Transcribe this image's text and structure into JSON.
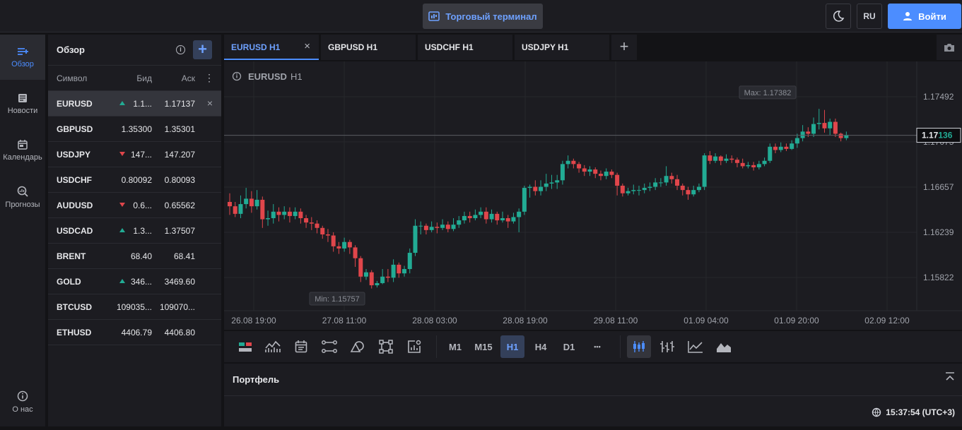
{
  "header": {
    "terminal_label": "Торговый терминал",
    "lang": "RU",
    "login_label": "Войти"
  },
  "nav": {
    "items": [
      {
        "label": "Обзор",
        "icon": "overview-icon"
      },
      {
        "label": "Новости",
        "icon": "news-icon"
      },
      {
        "label": "Календарь",
        "icon": "calendar-icon"
      },
      {
        "label": "Прогнозы",
        "icon": "forecast-icon"
      }
    ],
    "about": "О нас"
  },
  "watchlist": {
    "title": "Обзор",
    "col_symbol": "Символ",
    "col_bid": "Бид",
    "col_ask": "Аск",
    "rows": [
      {
        "symbol": "EURUSD",
        "bid": "1.1...",
        "ask": "1.17137",
        "trend": "up"
      },
      {
        "symbol": "GBPUSD",
        "bid": "1.35300",
        "ask": "1.35301",
        "trend": ""
      },
      {
        "symbol": "USDJPY",
        "bid": "147...",
        "ask": "147.207",
        "trend": "down"
      },
      {
        "symbol": "USDCHF",
        "bid": "0.80092",
        "ask": "0.80093",
        "trend": ""
      },
      {
        "symbol": "AUDUSD",
        "bid": "0.6...",
        "ask": "0.65562",
        "trend": "down"
      },
      {
        "symbol": "USDCAD",
        "bid": "1.3...",
        "ask": "1.37507",
        "trend": "up"
      },
      {
        "symbol": "BRENT",
        "bid": "68.40",
        "ask": "68.41",
        "trend": ""
      },
      {
        "symbol": "GOLD",
        "bid": "346...",
        "ask": "3469.60",
        "trend": "up"
      },
      {
        "symbol": "BTCUSD",
        "bid": "109035...",
        "ask": "109070...",
        "trend": ""
      },
      {
        "symbol": "ETHUSD",
        "bid": "4406.79",
        "ask": "4406.80",
        "trend": ""
      }
    ]
  },
  "tabs": [
    {
      "label": "EURUSD H1"
    },
    {
      "label": "GBPUSD H1"
    },
    {
      "label": "USDCHF H1"
    },
    {
      "label": "USDJPY H1"
    }
  ],
  "chart_data": {
    "type": "candlestick",
    "symbol": "EURUSD",
    "timeframe": "H1",
    "yticks": [
      "1.17492",
      "1.17075",
      "1.16657",
      "1.16239",
      "1.15822"
    ],
    "xticks": [
      "26.08 19:00",
      "27.08 11:00",
      "28.08 03:00",
      "28.08 19:00",
      "29.08 11:00",
      "01.09 04:00",
      "01.09 20:00",
      "02.09 12:00"
    ],
    "current_price_prefix": "1.17",
    "current_price_suffix": "136",
    "max_label": "Max: 1.17382",
    "min_label": "Min: 1.15757",
    "ylim": [
      1.1555,
      1.1775
    ],
    "candles": [
      [
        1.1652,
        1.1648,
        1.166,
        1.164
      ],
      [
        1.1648,
        1.1641,
        1.1652,
        1.1638
      ],
      [
        1.1641,
        1.165,
        1.1658,
        1.1637
      ],
      [
        1.165,
        1.1655,
        1.1665,
        1.1646
      ],
      [
        1.1655,
        1.1648,
        1.1662,
        1.1642
      ],
      [
        1.1648,
        1.1654,
        1.1663,
        1.1645
      ],
      [
        1.1654,
        1.1636,
        1.1657,
        1.1628
      ],
      [
        1.1636,
        1.1637,
        1.1644,
        1.163
      ],
      [
        1.1637,
        1.1643,
        1.165,
        1.1632
      ],
      [
        1.1643,
        1.164,
        1.1647,
        1.1634
      ],
      [
        1.164,
        1.1643,
        1.1648,
        1.1636
      ],
      [
        1.1643,
        1.1639,
        1.1647,
        1.1633
      ],
      [
        1.1639,
        1.1643,
        1.1647,
        1.1636
      ],
      [
        1.1643,
        1.1637,
        1.1646,
        1.1632
      ],
      [
        1.1637,
        1.1633,
        1.164,
        1.1628
      ],
      [
        1.1633,
        1.1632,
        1.1638,
        1.1626
      ],
      [
        1.1632,
        1.1628,
        1.1635,
        1.1623
      ],
      [
        1.1628,
        1.1622,
        1.163,
        1.1618
      ],
      [
        1.1622,
        1.1621,
        1.1627,
        1.1615
      ],
      [
        1.1621,
        1.1611,
        1.1624,
        1.1606
      ],
      [
        1.1611,
        1.1609,
        1.1615,
        1.1604
      ],
      [
        1.1609,
        1.1615,
        1.1619,
        1.1606
      ],
      [
        1.1615,
        1.161,
        1.1617,
        1.1604
      ],
      [
        1.161,
        1.16,
        1.1612,
        1.1592
      ],
      [
        1.16,
        1.1583,
        1.1602,
        1.1578
      ],
      [
        1.1583,
        1.1587,
        1.159,
        1.158
      ],
      [
        1.1587,
        1.1575,
        1.1589,
        1.1572
      ],
      [
        1.1575,
        1.1577,
        1.1579,
        1.1573
      ],
      [
        1.1577,
        1.1583,
        1.159,
        1.1576
      ],
      [
        1.1583,
        1.1582,
        1.159,
        1.1578
      ],
      [
        1.1582,
        1.1594,
        1.1599,
        1.1578
      ],
      [
        1.1594,
        1.1586,
        1.1596,
        1.1582
      ],
      [
        1.1586,
        1.159,
        1.1593,
        1.1583
      ],
      [
        1.159,
        1.1605,
        1.1609,
        1.1586
      ],
      [
        1.1605,
        1.163,
        1.1636,
        1.1602
      ],
      [
        1.163,
        1.163,
        1.1634,
        1.1622
      ],
      [
        1.163,
        1.1626,
        1.1632,
        1.1622
      ],
      [
        1.1626,
        1.1629,
        1.1634,
        1.1624
      ],
      [
        1.1629,
        1.1628,
        1.1633,
        1.1623
      ],
      [
        1.1628,
        1.1631,
        1.1636,
        1.1626
      ],
      [
        1.1631,
        1.1627,
        1.1634,
        1.1624
      ],
      [
        1.1627,
        1.1631,
        1.1637,
        1.1625
      ],
      [
        1.1631,
        1.1635,
        1.1639,
        1.1628
      ],
      [
        1.1635,
        1.1639,
        1.1643,
        1.1632
      ],
      [
        1.1639,
        1.1637,
        1.1643,
        1.1633
      ],
      [
        1.1637,
        1.164,
        1.1645,
        1.1635
      ],
      [
        1.164,
        1.1643,
        1.1647,
        1.1637
      ],
      [
        1.1643,
        1.1636,
        1.1647,
        1.1632
      ],
      [
        1.1636,
        1.1641,
        1.1645,
        1.1633
      ],
      [
        1.1641,
        1.1635,
        1.1643,
        1.1631
      ],
      [
        1.1635,
        1.1637,
        1.1643,
        1.1633
      ],
      [
        1.1637,
        1.1634,
        1.164,
        1.1628
      ],
      [
        1.1634,
        1.1638,
        1.1642,
        1.1632
      ],
      [
        1.1638,
        1.1643,
        1.1646,
        1.1624
      ],
      [
        1.1643,
        1.1665,
        1.1667,
        1.164
      ],
      [
        1.1665,
        1.1666,
        1.1668,
        1.1656
      ],
      [
        1.1666,
        1.1662,
        1.1672,
        1.1658
      ],
      [
        1.1662,
        1.1666,
        1.1672,
        1.1658
      ],
      [
        1.1666,
        1.1669,
        1.1678,
        1.1662
      ],
      [
        1.1669,
        1.167,
        1.1677,
        1.1664
      ],
      [
        1.167,
        1.1672,
        1.1677,
        1.1664
      ],
      [
        1.1672,
        1.1687,
        1.169,
        1.1668
      ],
      [
        1.1687,
        1.169,
        1.1695,
        1.1683
      ],
      [
        1.169,
        1.1687,
        1.1692,
        1.1683
      ],
      [
        1.1687,
        1.1683,
        1.1689,
        1.1679
      ],
      [
        1.1683,
        1.168,
        1.1686,
        1.1676
      ],
      [
        1.168,
        1.1682,
        1.1685,
        1.1676
      ],
      [
        1.1682,
        1.1678,
        1.1684,
        1.1674
      ],
      [
        1.1678,
        1.1676,
        1.1681,
        1.1672
      ],
      [
        1.1676,
        1.168,
        1.1683,
        1.1673
      ],
      [
        1.168,
        1.1677,
        1.1682,
        1.1674
      ],
      [
        1.1677,
        1.1667,
        1.1679,
        1.1658
      ],
      [
        1.1667,
        1.166,
        1.1669,
        1.1657
      ],
      [
        1.166,
        1.1662,
        1.1665,
        1.1658
      ],
      [
        1.1662,
        1.1663,
        1.1668,
        1.1659
      ],
      [
        1.1663,
        1.1663,
        1.1667,
        1.1658
      ],
      [
        1.1663,
        1.1665,
        1.1669,
        1.166
      ],
      [
        1.1665,
        1.1666,
        1.167,
        1.1662
      ],
      [
        1.1666,
        1.167,
        1.1674,
        1.1663
      ],
      [
        1.167,
        1.167,
        1.1674,
        1.1666
      ],
      [
        1.167,
        1.1676,
        1.1685,
        1.1667
      ],
      [
        1.1676,
        1.1673,
        1.1679,
        1.1669
      ],
      [
        1.1673,
        1.1667,
        1.1677,
        1.1663
      ],
      [
        1.1667,
        1.1663,
        1.1669,
        1.1658
      ],
      [
        1.1663,
        1.1659,
        1.1666,
        1.1654
      ],
      [
        1.1659,
        1.1663,
        1.1667,
        1.1657
      ],
      [
        1.1663,
        1.1666,
        1.1669,
        1.1661
      ],
      [
        1.1666,
        1.1695,
        1.1697,
        1.1663
      ],
      [
        1.1695,
        1.169,
        1.1699,
        1.1687
      ],
      [
        1.169,
        1.1694,
        1.1697,
        1.1688
      ],
      [
        1.1694,
        1.169,
        1.1695,
        1.1686
      ],
      [
        1.169,
        1.1692,
        1.1696,
        1.1688
      ],
      [
        1.1692,
        1.1691,
        1.1695,
        1.1688
      ],
      [
        1.1691,
        1.1688,
        1.1693,
        1.1684
      ],
      [
        1.1688,
        1.1685,
        1.1692,
        1.1683
      ],
      [
        1.1685,
        1.1686,
        1.1689,
        1.1683
      ],
      [
        1.1686,
        1.1684,
        1.1689,
        1.1681
      ],
      [
        1.1684,
        1.1687,
        1.169,
        1.1682
      ],
      [
        1.1687,
        1.169,
        1.1693,
        1.1685
      ],
      [
        1.169,
        1.1703,
        1.1706,
        1.1688
      ],
      [
        1.1703,
        1.17,
        1.1706,
        1.1697
      ],
      [
        1.17,
        1.1703,
        1.1707,
        1.1698
      ],
      [
        1.1703,
        1.1701,
        1.1706,
        1.1699
      ],
      [
        1.1701,
        1.1706,
        1.1709,
        1.17
      ],
      [
        1.1706,
        1.1711,
        1.1715,
        1.1702
      ],
      [
        1.1711,
        1.1717,
        1.1723,
        1.1708
      ],
      [
        1.1717,
        1.1715,
        1.1721,
        1.1712
      ],
      [
        1.1715,
        1.1724,
        1.173,
        1.1712
      ],
      [
        1.1724,
        1.1725,
        1.1738,
        1.1719
      ],
      [
        1.1725,
        1.172,
        1.1737,
        1.1716
      ],
      [
        1.172,
        1.1726,
        1.1729,
        1.1714
      ],
      [
        1.1726,
        1.1715,
        1.1729,
        1.1712
      ],
      [
        1.1715,
        1.1711,
        1.1716,
        1.1708
      ],
      [
        1.1711,
        1.1714,
        1.1717,
        1.1709
      ]
    ]
  },
  "toolbar": {
    "timeframes": [
      "M1",
      "M15",
      "H1",
      "H4",
      "D1",
      "•••"
    ],
    "active_tf": "H1"
  },
  "portfolio": {
    "title": "Портфель",
    "clock": "15:37:54 (UTC+3)"
  },
  "colors": {
    "up": "#22ab94",
    "down": "#e0464b",
    "accent": "#4c8dff"
  }
}
